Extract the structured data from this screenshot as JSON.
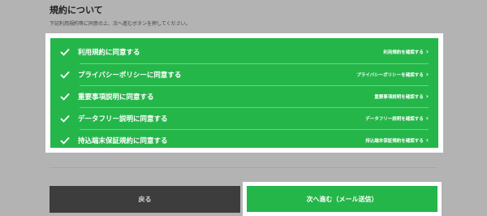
{
  "section": {
    "title": "規約について",
    "instruction": "下記利用規約等に同意の上、次へ進むボタンを押してください。"
  },
  "agreements": [
    {
      "label": "利用規約に同意する",
      "link": "利用規約を確認する"
    },
    {
      "label": "プライバシーポリシーに同意する",
      "link": "プライバシーポリシーを確認する"
    },
    {
      "label": "重要事項説明に同意する",
      "link": "重要事項説明を確認する"
    },
    {
      "label": "データフリー説明に同意する",
      "link": "データフリー説明を確認する"
    },
    {
      "label": "持込端末保証規約に同意する",
      "link": "持込端末保証規約を確認する"
    }
  ],
  "buttons": {
    "back": "戻る",
    "next": "次へ進む（メール送信）"
  },
  "colors": {
    "accent": "#25b64a",
    "back_button": "#3d3d3d",
    "overlay": "#b3b3b3"
  }
}
